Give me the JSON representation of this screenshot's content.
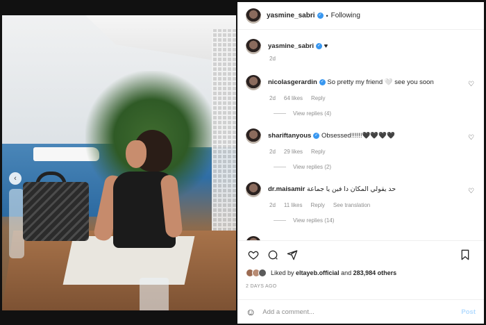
{
  "header": {
    "username": "yasmine_sabri",
    "separator": "•",
    "follow_status": "Following"
  },
  "caption": {
    "username": "yasmine_sabri",
    "text": "♥",
    "time": "2d"
  },
  "comments": [
    {
      "username": "nicolasgerardin",
      "text": "So pretty my friend 🤍 see you soon",
      "time": "2d",
      "likes": "64 likes",
      "reply_label": "Reply",
      "view_replies": "View replies (4)"
    },
    {
      "username": "shariftanyous",
      "text": "Obsessed!!!!!!🖤🖤🖤🖤",
      "time": "2d",
      "likes": "29 likes",
      "reply_label": "Reply",
      "view_replies": "View replies (2)"
    },
    {
      "username": "dr.maisamir",
      "text": "حد يقولي المكان دا فين يا جماعة",
      "time": "2d",
      "likes": "11 likes",
      "reply_label": "Reply",
      "see_translation": "See translation",
      "view_replies": "View replies (14)"
    }
  ],
  "liked_by": {
    "prefix": "Liked by",
    "user": "eltayeb.official",
    "and": "and",
    "count": "283,984 others"
  },
  "timestamp": "2 DAYS AGO",
  "add_comment": {
    "placeholder": "Add a comment...",
    "post_label": "Post"
  },
  "carousel": {
    "prev_glyph": "‹",
    "current_index": 1,
    "total": 2
  },
  "icons": {
    "heart": "heart-icon",
    "comment": "comment-icon",
    "share": "share-icon",
    "bookmark": "bookmark-icon",
    "emoji": "emoji-icon"
  },
  "colors": {
    "verified": "#3897f0",
    "muted": "#8e8e8e",
    "post_disabled": "#b3dbff"
  }
}
